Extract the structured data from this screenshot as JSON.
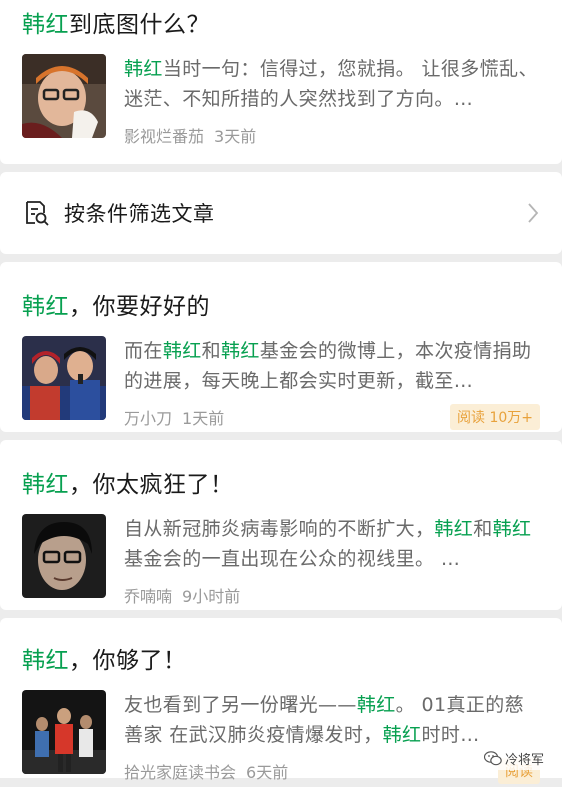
{
  "articles": [
    {
      "title_parts": [
        {
          "t": "韩红",
          "hl": true
        },
        {
          "t": "到底图什么？",
          "hl": false
        }
      ],
      "snippet_parts": [
        {
          "t": "韩红",
          "hl": true
        },
        {
          "t": "当时一句：信得过，您就捐。 让很多慌乱、迷茫、不知所措的人突然找到了方向。…",
          "hl": false
        }
      ],
      "source": "影视烂番茄",
      "time": "3天前",
      "read": ""
    },
    {
      "title_parts": [
        {
          "t": "韩红",
          "hl": true
        },
        {
          "t": "，你要好好的",
          "hl": false
        }
      ],
      "snippet_parts": [
        {
          "t": "而在",
          "hl": false
        },
        {
          "t": "韩红",
          "hl": true
        },
        {
          "t": "和",
          "hl": false
        },
        {
          "t": "韩红",
          "hl": true
        },
        {
          "t": "基金会的微博上，本次疫情捐助的进展，每天晚上都会实时更新，截至…",
          "hl": false
        }
      ],
      "source": "万小刀",
      "time": "1天前",
      "read": "阅读 10万+"
    },
    {
      "title_parts": [
        {
          "t": "韩红",
          "hl": true
        },
        {
          "t": "，你太疯狂了！",
          "hl": false
        }
      ],
      "snippet_parts": [
        {
          "t": "自从新冠肺炎病毒影响的不断扩大，",
          "hl": false
        },
        {
          "t": "韩红",
          "hl": true
        },
        {
          "t": "和",
          "hl": false
        },
        {
          "t": "韩红",
          "hl": true
        },
        {
          "t": "基金会的一直出现在公众的视线里。 …",
          "hl": false
        }
      ],
      "source": "乔喃喃",
      "time": "9小时前",
      "read": ""
    },
    {
      "title_parts": [
        {
          "t": "韩红",
          "hl": true
        },
        {
          "t": "，你够了！",
          "hl": false
        }
      ],
      "snippet_parts": [
        {
          "t": "友也看到了另一份曙光——",
          "hl": false
        },
        {
          "t": "韩红",
          "hl": true
        },
        {
          "t": "。 01真正的慈善家 在武汉肺炎疫情爆发时，",
          "hl": false
        },
        {
          "t": "韩红",
          "hl": true
        },
        {
          "t": "时时…",
          "hl": false
        }
      ],
      "source": "拾光家庭读书会",
      "time": "6天前",
      "read": "阅读"
    }
  ],
  "filter": {
    "label": "按条件筛选文章",
    "icon": "filter-document-search-icon"
  },
  "watermark": {
    "text": "冷将军",
    "icon": "wechat-icon"
  },
  "colors": {
    "highlight": "#07a050",
    "read_badge_bg": "#fbeed6",
    "read_badge_text": "#e8a23c",
    "meta_text": "#9a9a9a"
  }
}
